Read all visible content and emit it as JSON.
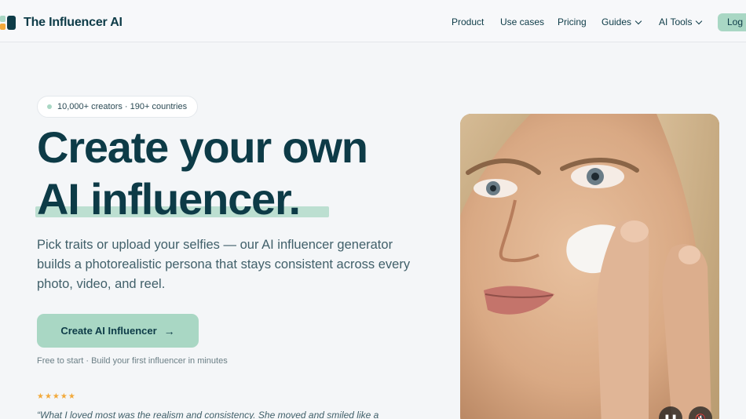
{
  "header": {
    "brand": "The Influencer AI",
    "nav": {
      "product": "Product",
      "use_cases": "Use cases",
      "pricing": "Pricing",
      "guides": "Guides",
      "ai_tools": "AI Tools"
    },
    "login": "Log"
  },
  "hero": {
    "badge": "10,000+ creators · 190+ countries",
    "title_line1": "Create your own",
    "title_line2": "AI influencer.",
    "description": "Pick traits or upload your selfies — our AI influencer generator builds a photorealistic persona that stays consistent across every photo, video, and reel.",
    "cta": "Create AI Influencer",
    "cta_icon": "arrow-right-icon",
    "subcta": "Free to start · Build your first influencer in minutes",
    "rating_stars": 5,
    "stars": "★★★★★",
    "quote": "“What I loved most was the realism and consistency. She moved and smiled like a"
  },
  "video": {
    "pause_icon": "pause-icon",
    "mute_icon": "mute-icon"
  },
  "colors": {
    "brand": "#0d3b47",
    "accent": "#a9d7c4",
    "star": "#f2a93b",
    "background": "#f4f6f8"
  }
}
